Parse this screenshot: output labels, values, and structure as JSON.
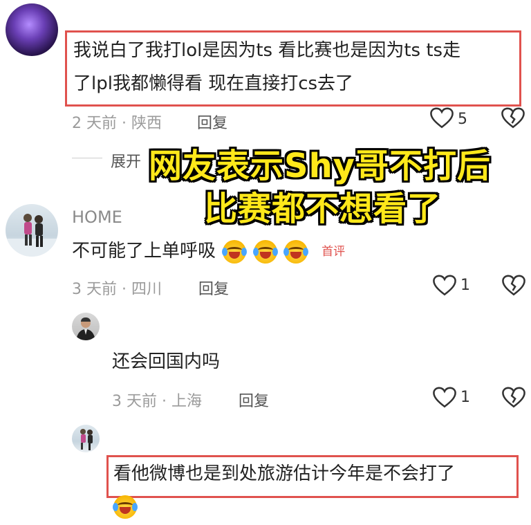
{
  "comments": [
    {
      "text_line1": "我说白了我打lol是因为ts 看比赛也是因为ts ts走",
      "text_line2": "了lpl我都懒得看 现在直接打cs去了",
      "meta": "2 天前 · 陕西",
      "reply": "回复",
      "likes": "5",
      "expand": "展开"
    },
    {
      "username": "HOME",
      "text": "不可能了上单呼吸",
      "badge": "首评",
      "meta": "3 天前 · 四川",
      "reply": "回复",
      "likes": "1"
    },
    {
      "text": "还会回国内吗",
      "meta": "3 天前 · 上海",
      "reply": "回复",
      "likes": "1"
    },
    {
      "text": "看他微博也是到处旅游估计今年是不会打了"
    }
  ],
  "overlay": {
    "line1": "网友表示Shy哥不打后",
    "line2": "比赛都不想看了"
  },
  "icons": {
    "like": "heart-outline-icon",
    "dislike": "broken-heart-icon",
    "emoji": "laughing-crying-emoji"
  },
  "colors": {
    "highlight_box": "#e0524e",
    "overlay_text": "#ffe81a",
    "meta_text": "#9a9a9a"
  }
}
